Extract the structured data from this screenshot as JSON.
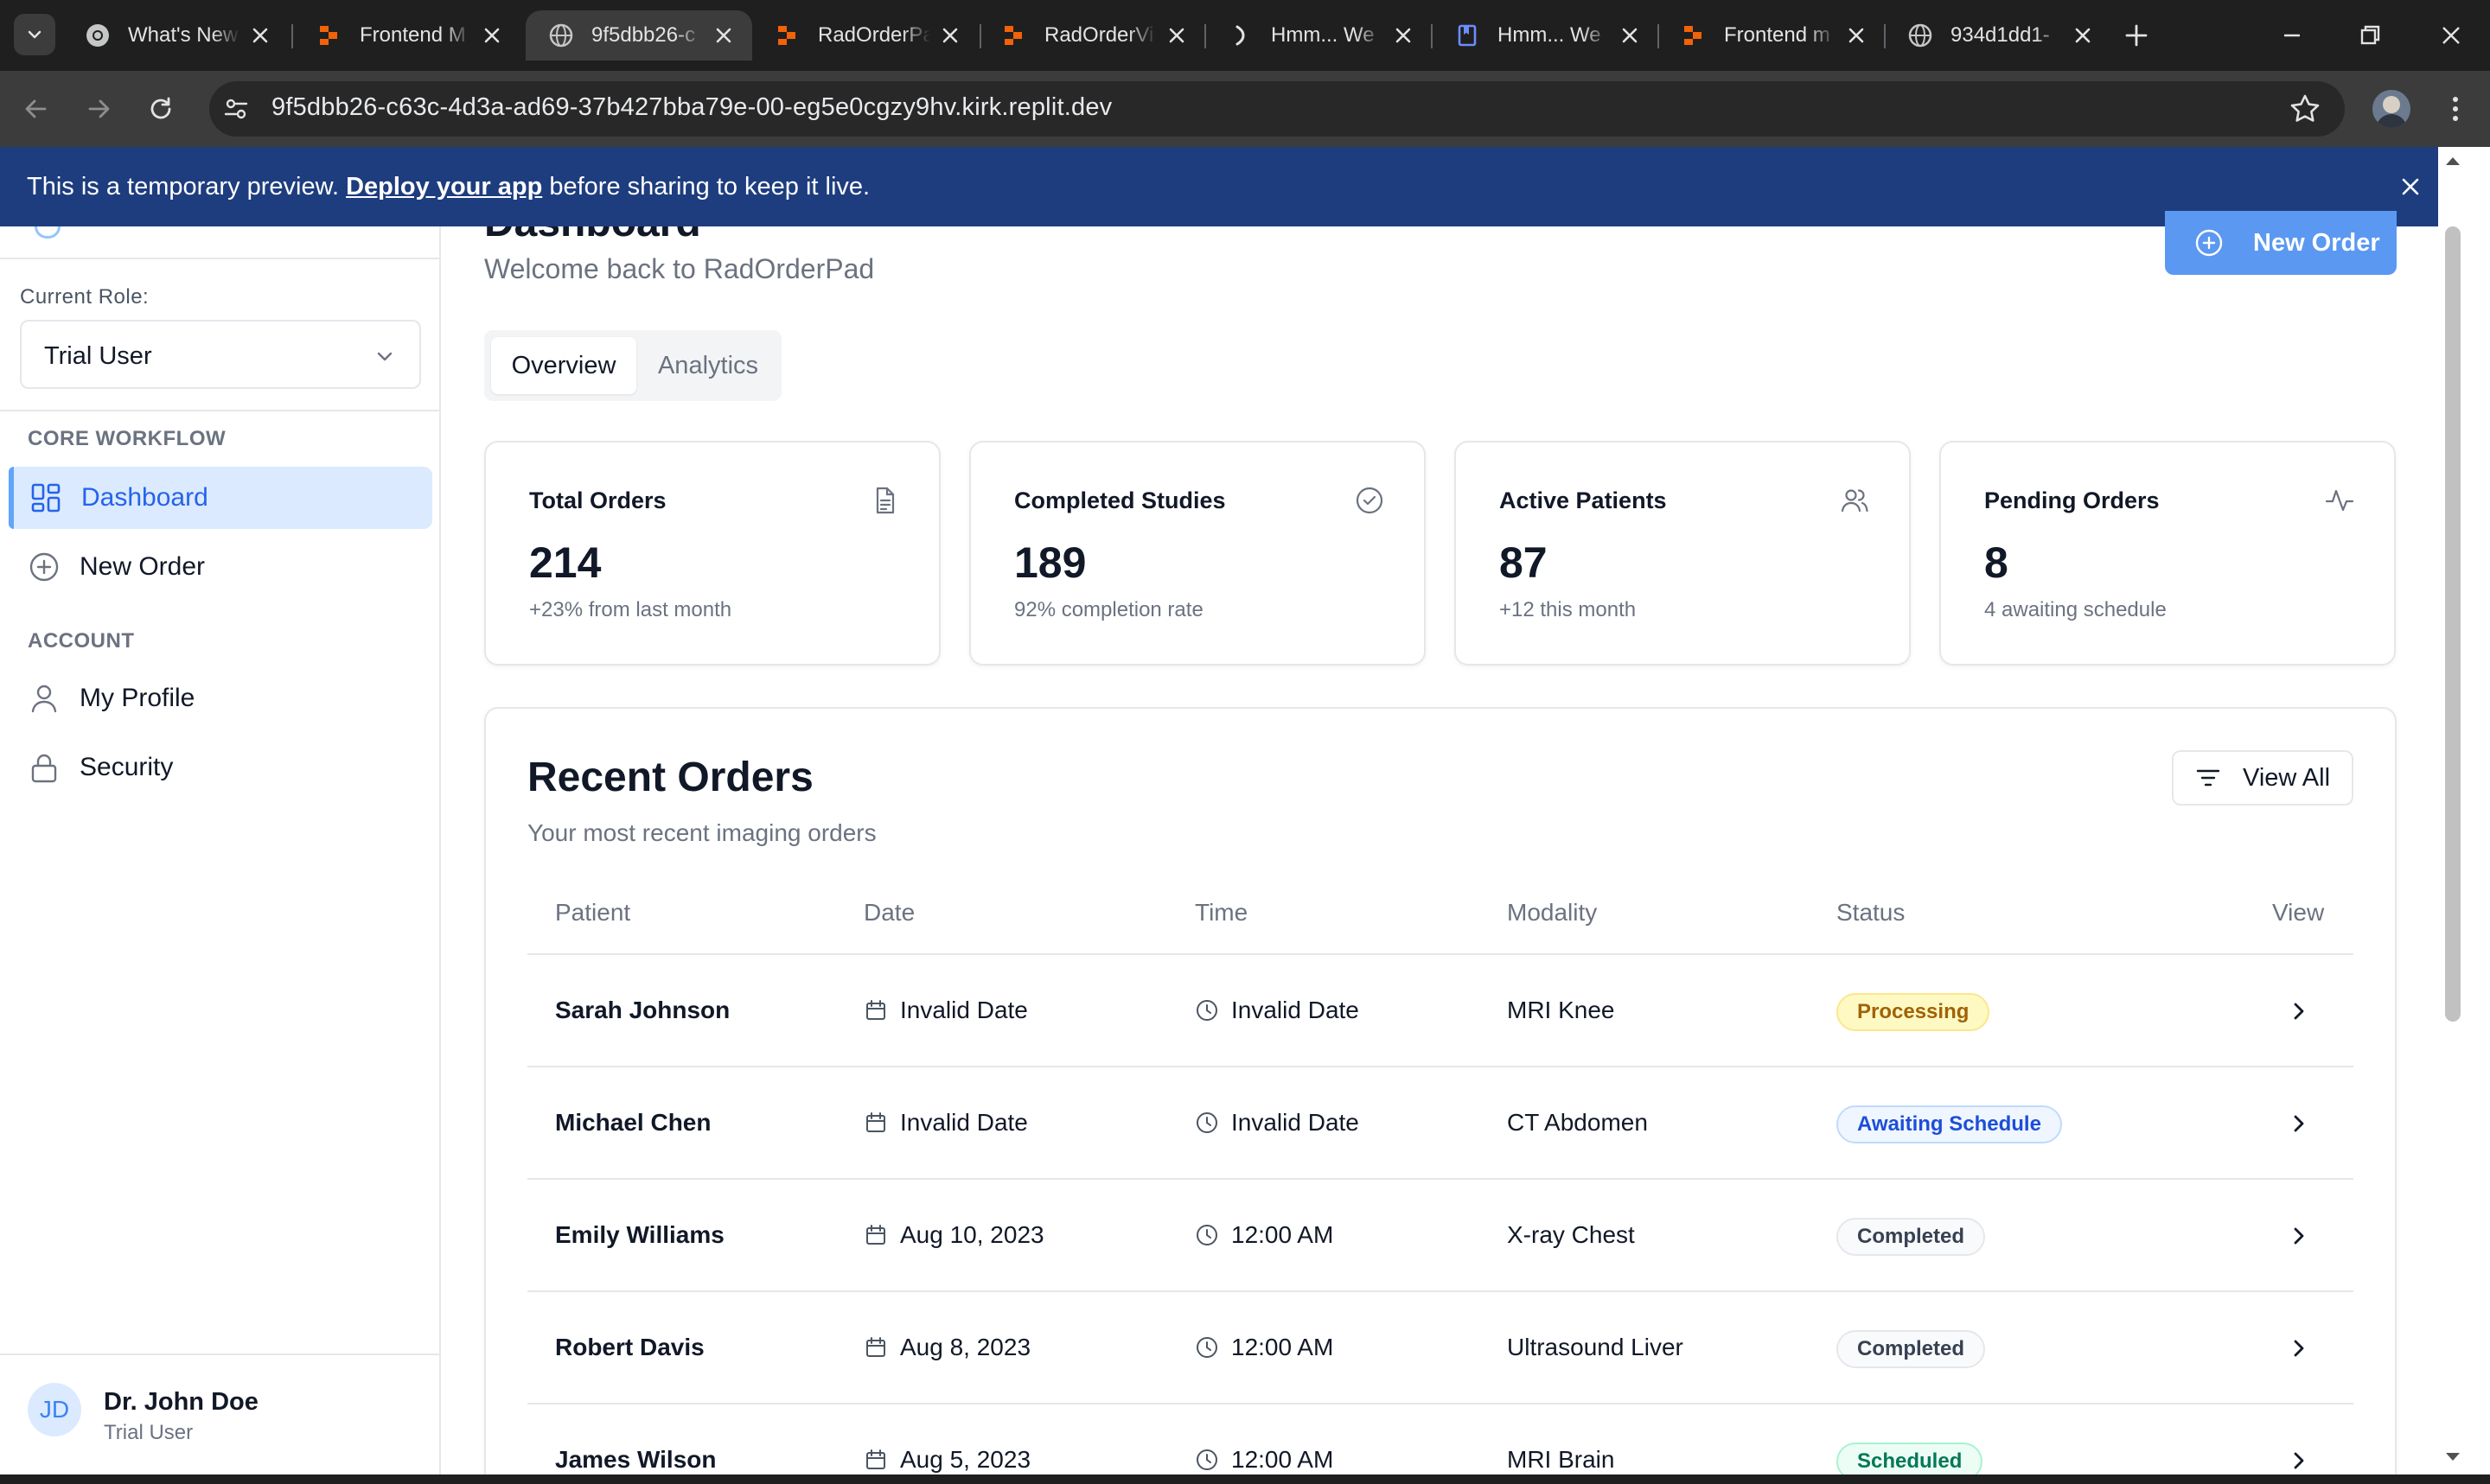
{
  "browser": {
    "tabs": [
      {
        "title": "What's New",
        "favicon": "chrome"
      },
      {
        "title": "Frontend M",
        "favicon": "replit"
      },
      {
        "title": "9f5dbb26-c",
        "favicon": "globe"
      },
      {
        "title": "RadOrderPa",
        "favicon": "replit"
      },
      {
        "title": "RadOrderVi",
        "favicon": "replit"
      },
      {
        "title": "Hmm... We",
        "favicon": "bracket"
      },
      {
        "title": "Hmm... We",
        "favicon": "doc"
      },
      {
        "title": "Frontend m",
        "favicon": "replit"
      },
      {
        "title": "934d1dd1-",
        "favicon": "globe"
      }
    ],
    "url": "9f5dbb26-c63c-4d3a-ad69-37b427bba79e-00-eg5e0cgzy9hv.kirk.replit.dev"
  },
  "banner": {
    "prefix": "This is a temporary preview.",
    "link": "Deploy your app",
    "suffix": "before sharing to keep it live."
  },
  "sidebar": {
    "role_label": "Current Role:",
    "role_value": "Trial User",
    "sections": [
      {
        "heading": "CORE WORKFLOW",
        "items": [
          {
            "label": "Dashboard",
            "icon": "grid-icon",
            "active": true
          },
          {
            "label": "New Order",
            "icon": "plus-circle-icon",
            "active": false
          }
        ]
      },
      {
        "heading": "ACCOUNT",
        "items": [
          {
            "label": "My Profile",
            "icon": "user-icon",
            "active": false
          },
          {
            "label": "Security",
            "icon": "lock-icon",
            "active": false
          }
        ]
      }
    ],
    "user": {
      "initials": "JD",
      "name": "Dr. John Doe",
      "role": "Trial User"
    }
  },
  "header": {
    "title": "Dashboard",
    "subtitle": "Welcome back to RadOrderPad",
    "new_order_label": "New Order"
  },
  "tabs": [
    {
      "label": "Overview",
      "active": true
    },
    {
      "label": "Analytics",
      "active": false
    }
  ],
  "stats": [
    {
      "title": "Total Orders",
      "value": "214",
      "sub": "+23% from last month",
      "icon": "file-icon"
    },
    {
      "title": "Completed Studies",
      "value": "189",
      "sub": "92% completion rate",
      "icon": "check-circle-icon"
    },
    {
      "title": "Active Patients",
      "value": "87",
      "sub": "+12 this month",
      "icon": "users-icon"
    },
    {
      "title": "Pending Orders",
      "value": "8",
      "sub": "4 awaiting schedule",
      "icon": "activity-icon"
    }
  ],
  "recent": {
    "title": "Recent Orders",
    "subtitle": "Your most recent imaging orders",
    "view_all_label": "View All",
    "columns": [
      "Patient",
      "Date",
      "Time",
      "Modality",
      "Status",
      "View"
    ],
    "rows": [
      {
        "patient": "Sarah Johnson",
        "date": "Invalid Date",
        "time": "Invalid Date",
        "modality": "MRI Knee",
        "status": "Processing"
      },
      {
        "patient": "Michael Chen",
        "date": "Invalid Date",
        "time": "Invalid Date",
        "modality": "CT Abdomen",
        "status": "Awaiting Schedule"
      },
      {
        "patient": "Emily Williams",
        "date": "Aug 10, 2023",
        "time": "12:00 AM",
        "modality": "X-ray Chest",
        "status": "Completed"
      },
      {
        "patient": "Robert Davis",
        "date": "Aug 8, 2023",
        "time": "12:00 AM",
        "modality": "Ultrasound Liver",
        "status": "Completed"
      },
      {
        "patient": "James Wilson",
        "date": "Aug 5, 2023",
        "time": "12:00 AM",
        "modality": "MRI Brain",
        "status": "Scheduled"
      }
    ]
  },
  "colors": {
    "accent": "#3b82f6",
    "banner": "#1e3d7f",
    "processing": "#a16207",
    "awaiting": "#1d4ed8",
    "completed": "#374151",
    "scheduled": "#047857"
  }
}
